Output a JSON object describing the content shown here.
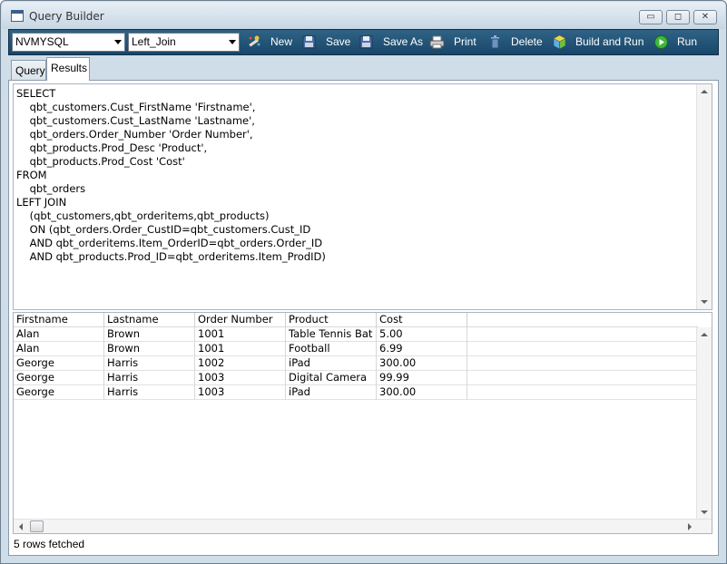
{
  "window": {
    "title": "Query Builder",
    "minimize_glyph": "▭",
    "maximize_glyph": "◻",
    "close_glyph": "✕"
  },
  "toolbar": {
    "connection_value": "NVMYSQL",
    "query_value": "Left_Join",
    "buttons": [
      {
        "label": "New",
        "icon": "magic-wand-icon"
      },
      {
        "label": "Save",
        "icon": "floppy-disk-icon"
      },
      {
        "label": "Save As",
        "icon": "floppy-disk-icon"
      },
      {
        "label": "Print",
        "icon": "printer-icon"
      },
      {
        "label": "Delete",
        "icon": "trash-can-icon"
      },
      {
        "label": "Build and Run",
        "icon": "cube-icon"
      },
      {
        "label": "Run",
        "icon": "play-icon"
      }
    ]
  },
  "tabs": [
    {
      "label": "Query",
      "active": false
    },
    {
      "label": "Results",
      "active": true
    }
  ],
  "sql": {
    "text": "SELECT\n    qbt_customers.Cust_FirstName 'Firstname',\n    qbt_customers.Cust_LastName 'Lastname',\n    qbt_orders.Order_Number 'Order Number',\n    qbt_products.Prod_Desc 'Product',\n    qbt_products.Prod_Cost 'Cost'\nFROM\n    qbt_orders\nLEFT JOIN\n    (qbt_customers,qbt_orderitems,qbt_products)\n    ON (qbt_orders.Order_CustID=qbt_customers.Cust_ID\n    AND qbt_orderitems.Item_OrderID=qbt_orders.Order_ID\n    AND qbt_products.Prod_ID=qbt_orderitems.Item_ProdID)"
  },
  "grid": {
    "columns": [
      "Firstname",
      "Lastname",
      "Order Number",
      "Product",
      "Cost"
    ],
    "rows": [
      [
        "Alan",
        "Brown",
        "1001",
        "Table Tennis Bat",
        "5.00"
      ],
      [
        "Alan",
        "Brown",
        "1001",
        "Football",
        "6.99"
      ],
      [
        "George",
        "Harris",
        "1002",
        "iPad",
        "300.00"
      ],
      [
        "George",
        "Harris",
        "1003",
        "Digital Camera",
        "99.99"
      ],
      [
        "George",
        "Harris",
        "1003",
        "iPad",
        "300.00"
      ]
    ]
  },
  "status": {
    "text": "5 rows fetched"
  },
  "colors": {
    "toolbar_bg": "#1f5278",
    "toolbar_text": "#ffffff",
    "window_frame": "#cfdde9"
  }
}
